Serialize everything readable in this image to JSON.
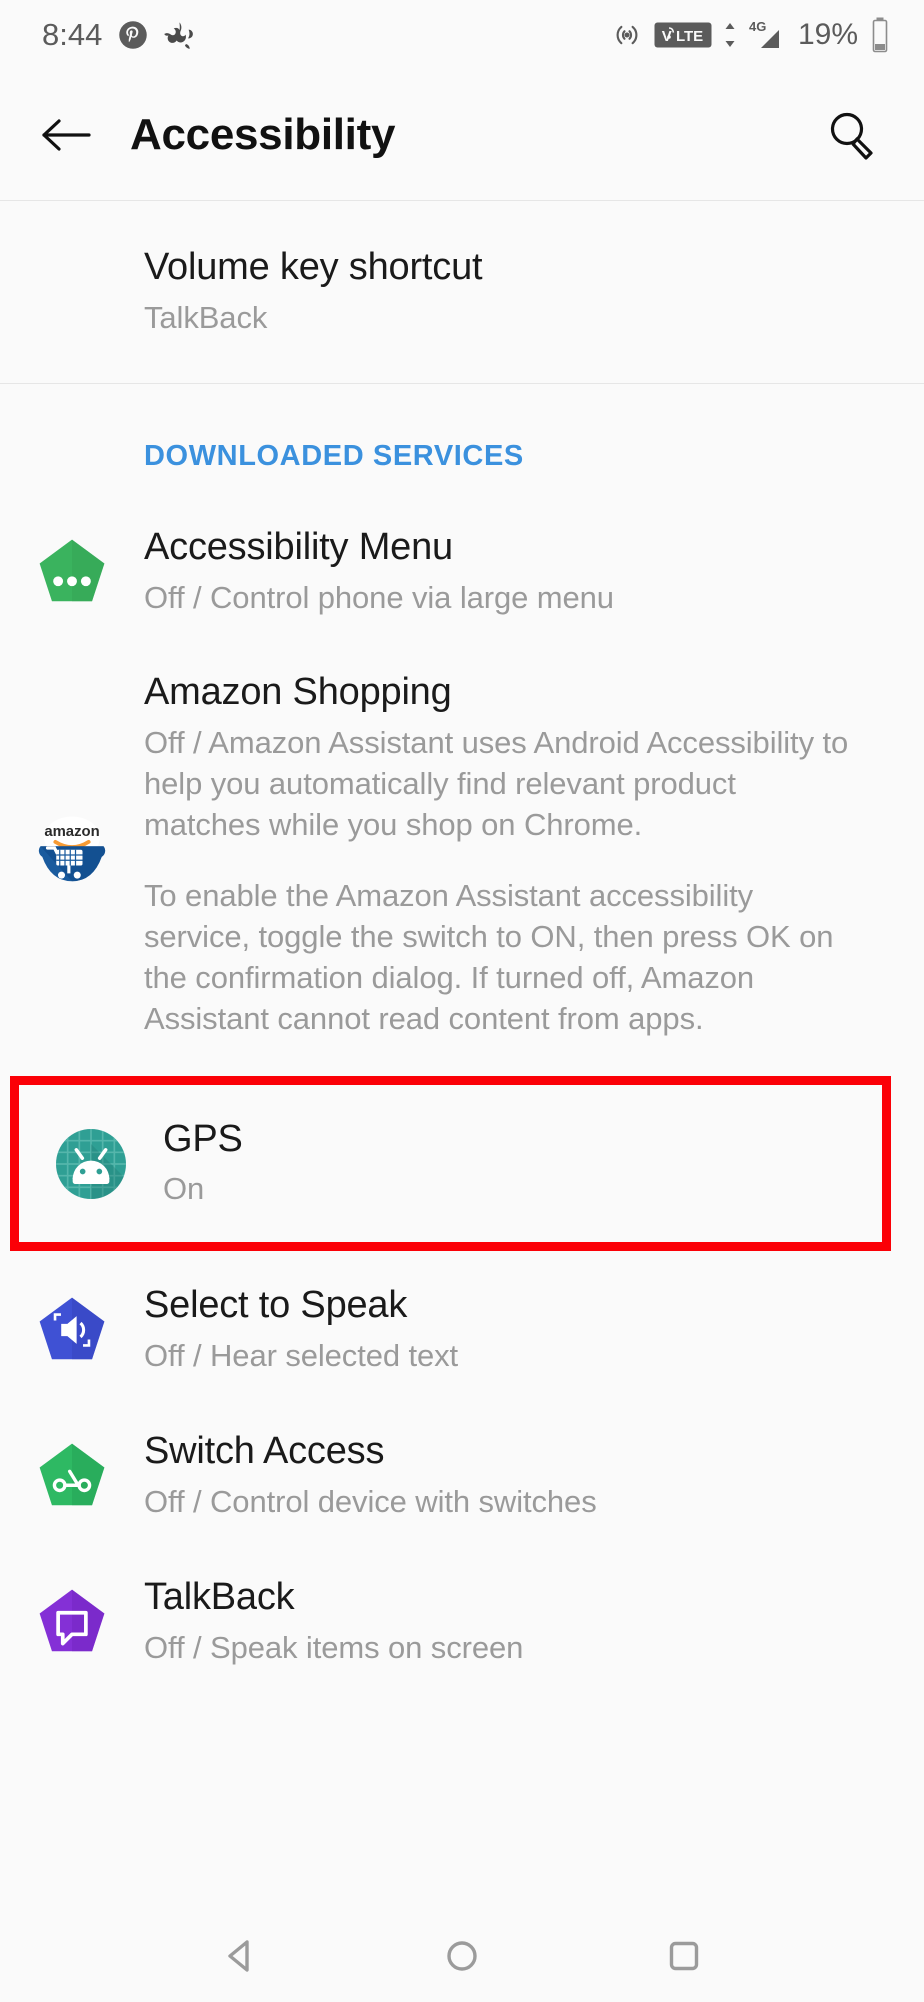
{
  "status_bar": {
    "time": "8:44",
    "left_icons": [
      "pinterest-icon",
      "app-icon"
    ],
    "right_icons": [
      "hotspot-icon",
      "volte-icon",
      "signal-4g-icon"
    ],
    "volte_label": "VoLTE",
    "network_label": "4G",
    "battery_percent": "19%"
  },
  "app_bar": {
    "back_icon": "back-arrow-icon",
    "title": "Accessibility",
    "search_icon": "search-icon"
  },
  "volume_shortcut": {
    "title": "Volume key shortcut",
    "subtitle": "TalkBack"
  },
  "section": {
    "header": "DOWNLOADED SERVICES",
    "header_color": "#3b91de"
  },
  "services": [
    {
      "id": "accessibility-menu",
      "icon": "green-pentagon-dots-icon",
      "title": "Accessibility Menu",
      "subtitle": "Off / Control phone via large menu"
    },
    {
      "id": "amazon-shopping",
      "icon": "amazon-cart-icon",
      "title": "Amazon Shopping",
      "subtitle_p1": "Off / Amazon Assistant uses Android Accessibility to help you automatically find relevant product matches while you shop on Chrome.",
      "subtitle_p2": "To enable the Amazon Assistant accessibility service, toggle the switch to ON, then press OK on the confirmation dialog. If turned off, Amazon Assistant cannot read content from apps."
    },
    {
      "id": "gps",
      "icon": "android-robot-teal-icon",
      "title": "GPS",
      "subtitle": "On",
      "highlighted": true,
      "highlight_color": "#fb0007"
    },
    {
      "id": "select-to-speak",
      "icon": "blue-pentagon-speaker-icon",
      "title": "Select to Speak",
      "subtitle": "Off / Hear selected text"
    },
    {
      "id": "switch-access",
      "icon": "green-pentagon-switch-icon",
      "title": "Switch Access",
      "subtitle": "Off / Control device with switches"
    },
    {
      "id": "talkback",
      "icon": "purple-pentagon-speech-icon",
      "title": "TalkBack",
      "subtitle": "Off / Speak items on screen"
    }
  ],
  "nav_bar": {
    "back": "nav-back-triangle-icon",
    "home": "nav-home-circle-icon",
    "recents": "nav-recents-square-icon"
  }
}
